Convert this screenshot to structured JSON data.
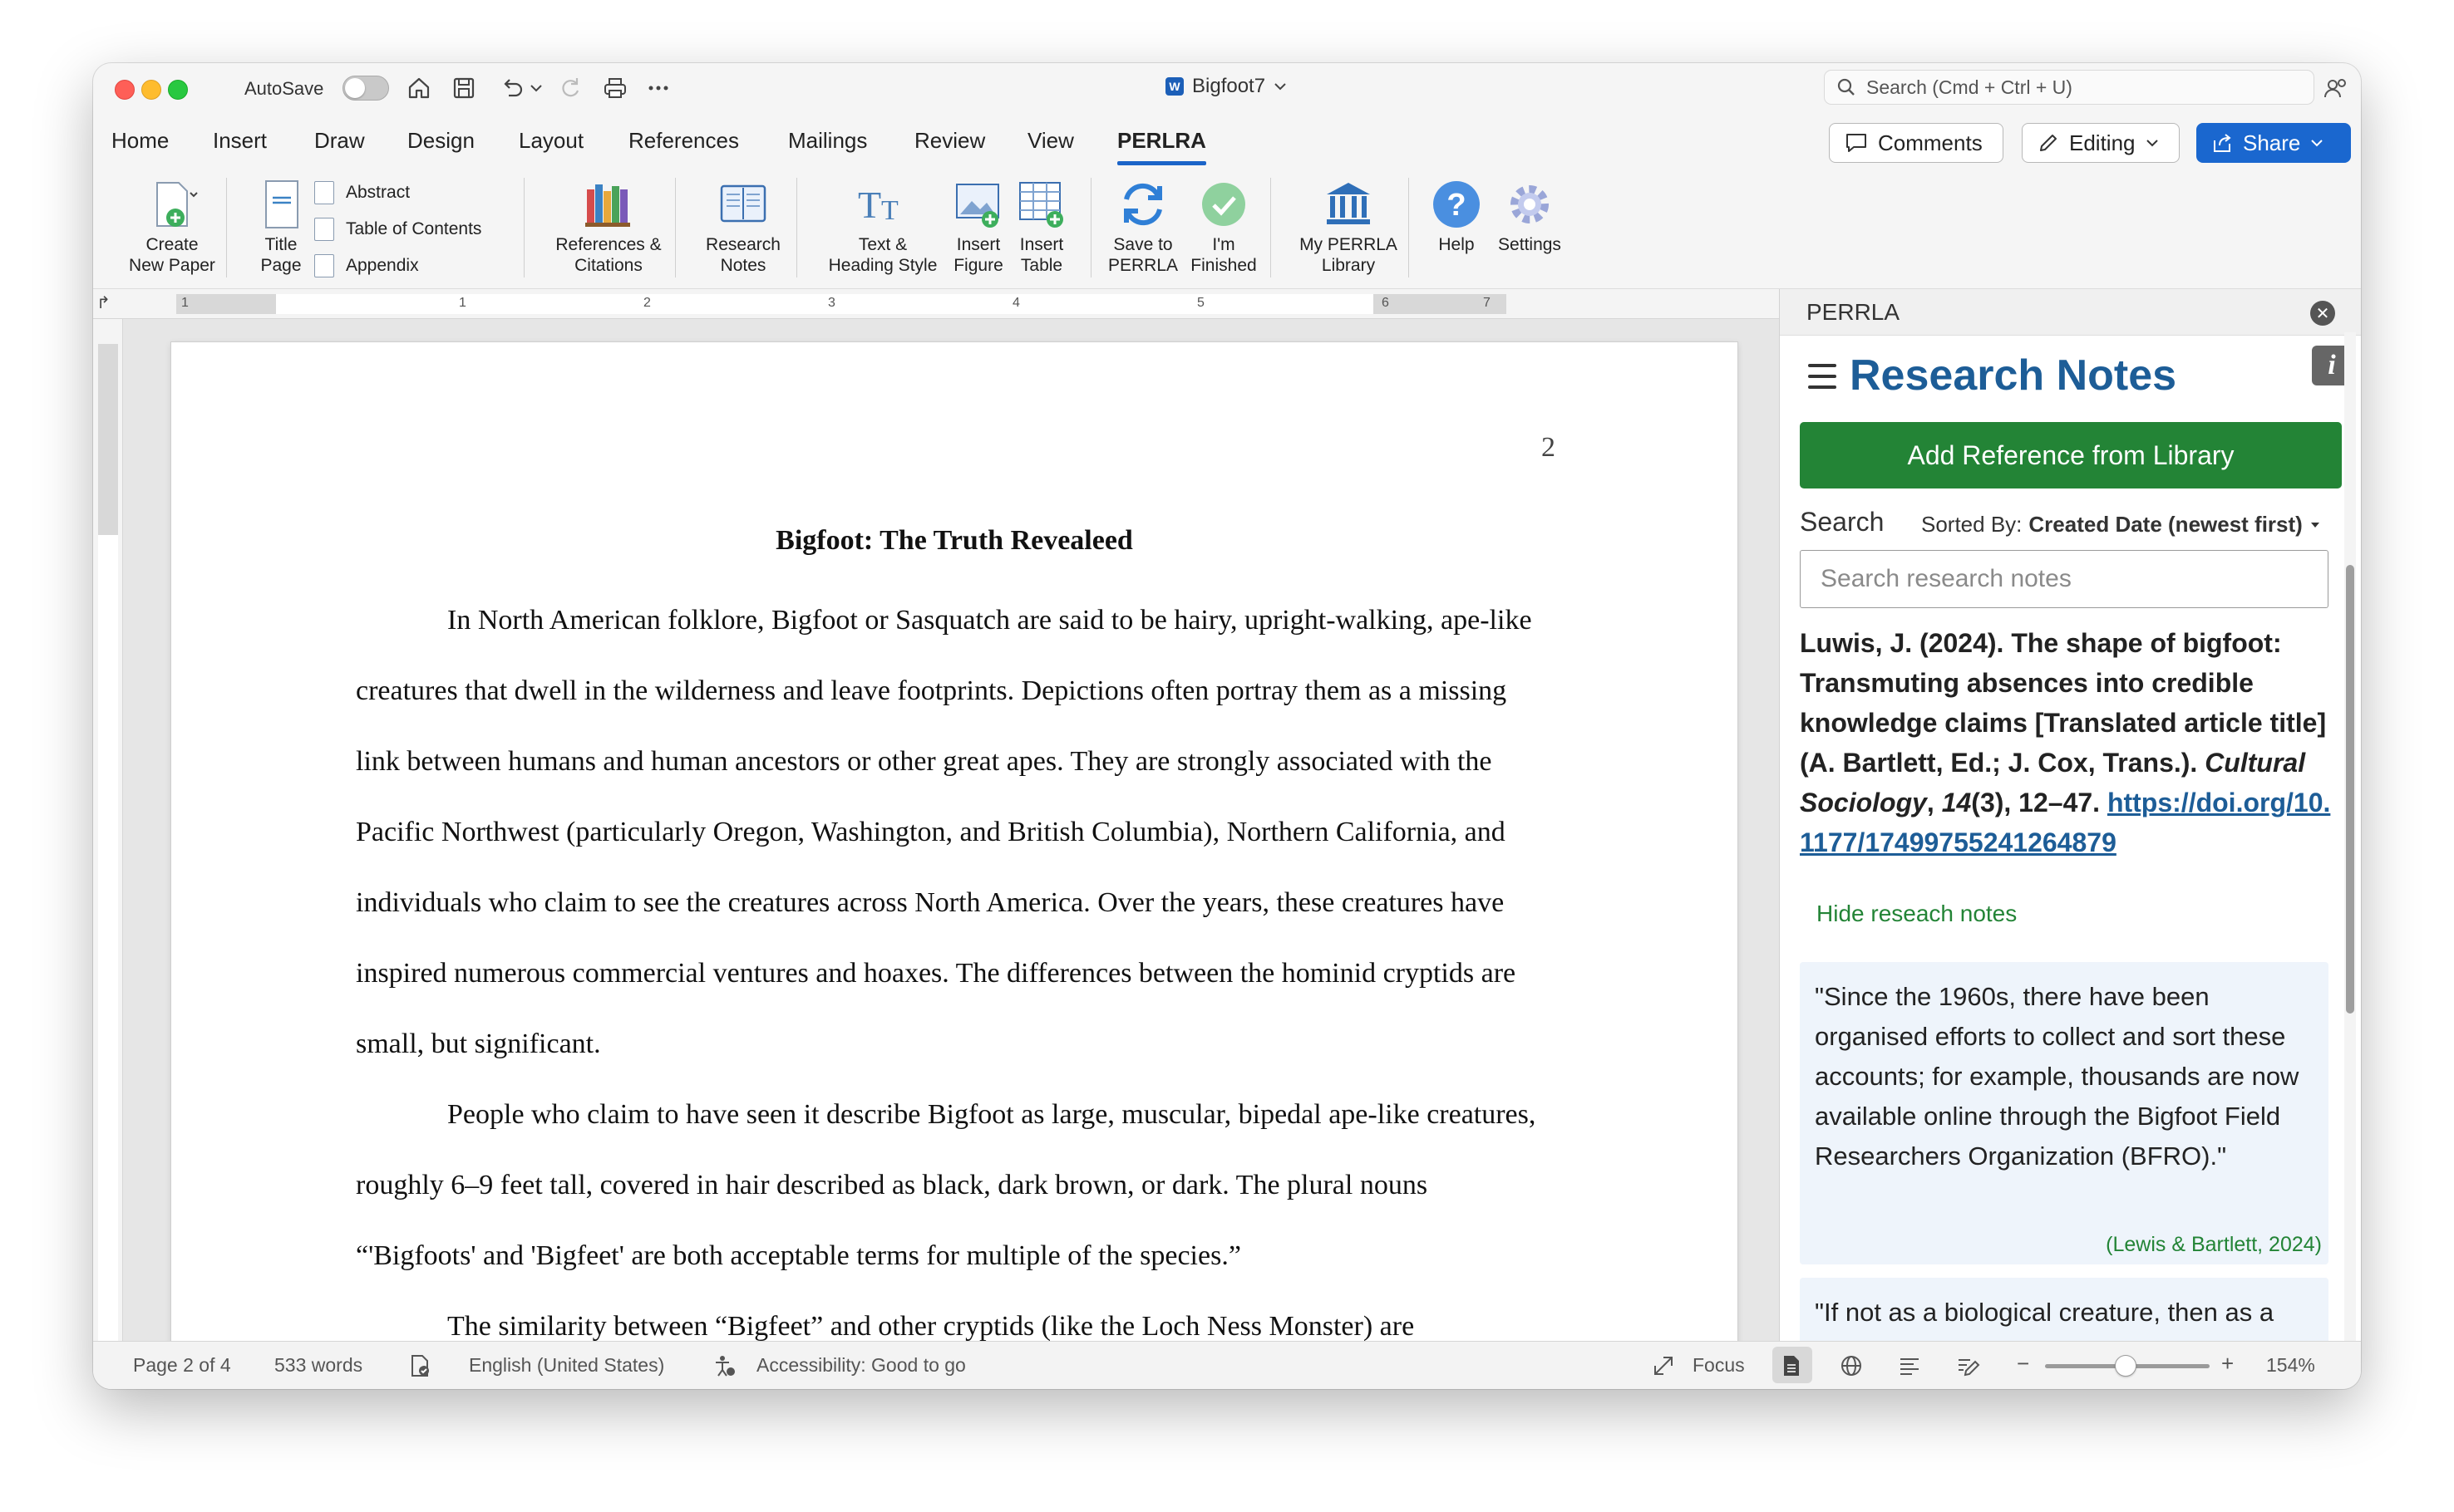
{
  "titlebar": {
    "autosave_label": "AutoSave",
    "doc_title": "Bigfoot7",
    "search_placeholder": "Search (Cmd + Ctrl + U)"
  },
  "tabs": [
    "Home",
    "Insert",
    "Draw",
    "Design",
    "Layout",
    "References",
    "Mailings",
    "Review",
    "View",
    "PERLRA"
  ],
  "actions": {
    "comments": "Comments",
    "editing": "Editing",
    "share": "Share"
  },
  "ribbon": {
    "create_new_paper": [
      "Create",
      "New Paper"
    ],
    "title_page": [
      "Title",
      "Page"
    ],
    "abstract": "Abstract",
    "table_of_contents": "Table of Contents",
    "appendix": "Appendix",
    "references_citations": [
      "References &",
      "Citations"
    ],
    "research_notes": [
      "Research",
      "Notes"
    ],
    "text_heading": [
      "Text &",
      "Heading Style"
    ],
    "insert_figure": [
      "Insert",
      "Figure"
    ],
    "insert_table": [
      "Insert",
      "Table"
    ],
    "save_to_perrla": [
      "Save to",
      "PERRLA"
    ],
    "im_finished": [
      "I'm",
      "Finished"
    ],
    "my_perrla_library": [
      "My PERRLA",
      "Library"
    ],
    "help": "Help",
    "settings": "Settings"
  },
  "ruler": [
    "1",
    "1",
    "2",
    "3",
    "4",
    "5",
    "6",
    "7"
  ],
  "document": {
    "page_number": "2",
    "title": "Bigfoot: The Truth Revealeed",
    "paragraphs": [
      "In North American folklore, Bigfoot or Sasquatch are said to be hairy, upright-walking, ape-like creatures that dwell in the wilderness and leave footprints. Depictions often portray them as a missing link between humans and human ancestors or other great apes. They are strongly associated with the Pacific Northwest (particularly Oregon, Washington, and British Columbia), Northern California, and individuals who claim to see the creatures across North America. Over the years, these creatures have inspired numerous commercial ventures and hoaxes. The differences between the hominid cryptids are small, but significant.",
      "People who claim to have seen it describe Bigfoot as large, muscular, bipedal ape-like creatures, roughly 6–9 feet tall, covered in hair described as black, dark brown, or dark. The plural nouns “'Bigfoots' and 'Bigfeet' are both acceptable terms for multiple of the species.”",
      "The similarity between “Bigfeet” and other cryptids (like the Loch Ness Monster) are"
    ]
  },
  "panel": {
    "header": "PERRLA",
    "title": "Research Notes",
    "add_button": "Add Reference from Library",
    "search_label": "Search",
    "sorted_prefix": "Sorted By:",
    "sorted_value": "Created Date (newest first)",
    "search_placeholder": "Search research notes",
    "reference": {
      "authors": "Luwis, J. (2024). The shape of bigfoot: Transmuting absences into credible knowledge claims [Translated article title] (A. Bartlett, Ed.; J. Cox, Trans.).",
      "journal": "Cultural Sociology",
      "volume": "14",
      "issue_pages": "(3), 12–47.",
      "doi": "https://doi.org/10.1177/17499755241264879"
    },
    "hide_notes": "Hide reseach notes",
    "note1": "\"Since the 1960s, there have been organised efforts to collect and sort these accounts; for example, thousands are now available online through the Bigfoot Field Researchers Organization (BFRO).\"",
    "note1_cite": "(Lewis & Bartlett, 2024)",
    "note2": "\"If not as a biological creature, then as a"
  },
  "status": {
    "page": "Page 2 of 4",
    "words": "533 words",
    "language": "English (United States)",
    "accessibility": "Accessibility: Good to go",
    "focus": "Focus",
    "zoom": "154%",
    "zoom_level_percent": 154
  }
}
